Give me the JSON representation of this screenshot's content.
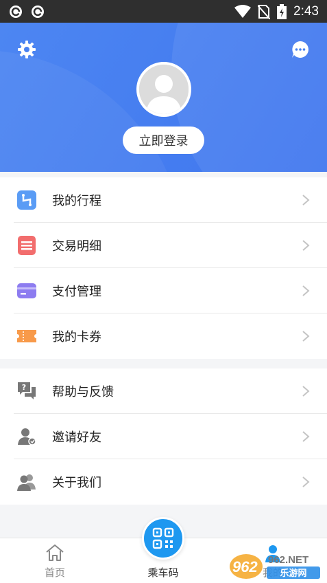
{
  "status_bar": {
    "time": "2:43"
  },
  "header": {
    "login_label": "立即登录"
  },
  "menu_group_1": [
    {
      "label": "我的行程",
      "icon": "trip-icon"
    },
    {
      "label": "交易明细",
      "icon": "transaction-icon"
    },
    {
      "label": "支付管理",
      "icon": "payment-card-icon"
    },
    {
      "label": "我的卡券",
      "icon": "coupon-icon"
    }
  ],
  "menu_group_2": [
    {
      "label": "帮助与反馈",
      "icon": "help-feedback-icon"
    },
    {
      "label": "邀请好友",
      "icon": "invite-friend-icon"
    },
    {
      "label": "关于我们",
      "icon": "about-us-icon"
    }
  ],
  "tabbar": {
    "home_label": "首页",
    "qr_label": "乘车码",
    "mine_label": "我的"
  },
  "watermark": {
    "text_top": "962.NET",
    "text_bottom": "乐游网"
  },
  "colors": {
    "header_blue": "#4d86f2",
    "qr_blue": "#1e98f0"
  }
}
